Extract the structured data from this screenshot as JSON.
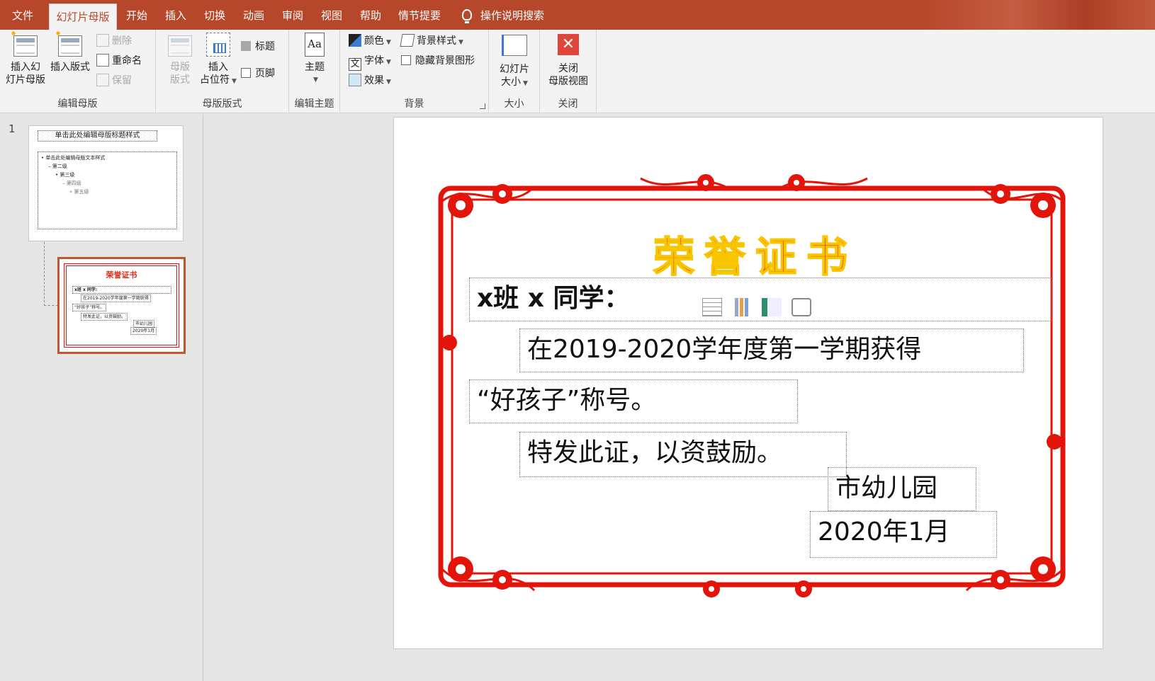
{
  "tabs": {
    "file": "文件",
    "slide_master": "幻灯片母版",
    "home": "开始",
    "insert": "插入",
    "transitions": "切换",
    "animations": "动画",
    "review": "审阅",
    "view": "视图",
    "help": "帮助",
    "storyboard": "情节提要",
    "tell_me": "操作说明搜索"
  },
  "ribbon": {
    "edit_master": {
      "label": "编辑母版",
      "insert_slide_master_l1": "插入幻",
      "insert_slide_master_l2": "灯片母版",
      "insert_layout": "插入版式",
      "delete": "删除",
      "rename": "重命名",
      "preserve": "保留"
    },
    "master_layout": {
      "label": "母版版式",
      "master_layout_l1": "母版",
      "master_layout_l2": "版式",
      "insert_placeholder_l1": "插入",
      "insert_placeholder_l2": "占位符",
      "title_checkbox": "标题",
      "footer_checkbox": "页脚"
    },
    "edit_theme": {
      "label": "编辑主题",
      "themes": "主题"
    },
    "background": {
      "label": "背景",
      "colors": "颜色",
      "fonts": "字体",
      "effects": "效果",
      "background_styles": "背景样式",
      "hide_background_graphics": "隐藏背景图形"
    },
    "size": {
      "label": "大小",
      "slide_size_l1": "幻灯片",
      "slide_size_l2": "大小"
    },
    "close": {
      "label": "关闭",
      "close_master_l1": "关闭",
      "close_master_l2": "母版视图"
    }
  },
  "thumbnails": {
    "slide_number": "1",
    "master_title": "单击此处编辑母版标题样式",
    "master_levels": [
      "• 单击此处编辑母版文本样式",
      "– 第二级",
      "• 第三级",
      "– 第四级",
      "» 第五级"
    ],
    "layout_title": "荣誉证书",
    "layout_lines": [
      "x班 x 同学:",
      "在2019-2020学年度第一学期获得",
      "“好孩子”称号。",
      "特发此证，以资鼓励。",
      "市幼儿园",
      "2020年1月"
    ]
  },
  "slide": {
    "title": "荣誉证书",
    "line1": "x班 x 同学：",
    "line2": "在2019-2020学年度第一学期获得",
    "line3": "“好孩子”称号。",
    "line4": "特发此证，以资鼓励。",
    "line5": "市幼儿园",
    "line6": "2020年1月"
  },
  "colors": {
    "accent": "#b7472a",
    "certificate_red": "#e31d0a",
    "title_outline": "#f7c600"
  },
  "icons": [
    "lightbulb-icon",
    "insert-slide-master-icon",
    "insert-layout-icon",
    "delete-icon",
    "rename-icon",
    "preserve-icon",
    "master-layout-icon",
    "insert-placeholder-icon",
    "themes-icon",
    "colors-icon",
    "fonts-icon",
    "effects-icon",
    "background-styles-icon",
    "slide-size-icon",
    "close-master-icon",
    "insert-table-icon",
    "insert-chart-icon",
    "insert-smartart-icon",
    "insert-3d-model-icon"
  ]
}
